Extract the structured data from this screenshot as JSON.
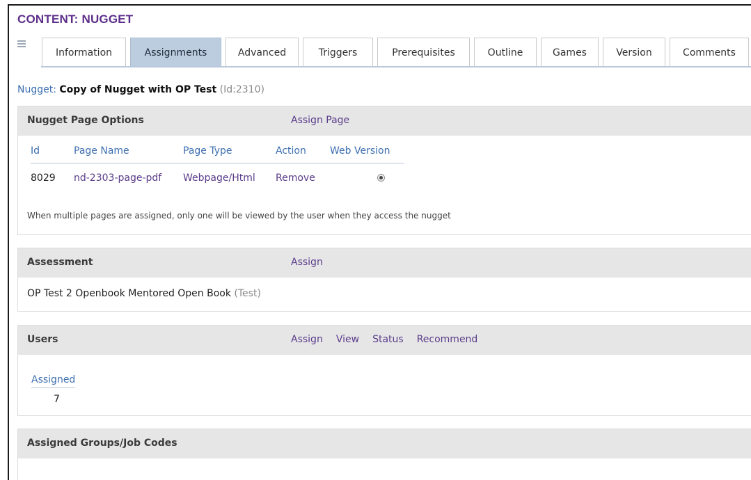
{
  "page": {
    "title": "CONTENT: NUGGET"
  },
  "tabs": [
    {
      "label": "Information"
    },
    {
      "label": "Assignments"
    },
    {
      "label": "Advanced"
    },
    {
      "label": "Triggers"
    },
    {
      "label": "Prerequisites"
    },
    {
      "label": "Outline"
    },
    {
      "label": "Games"
    },
    {
      "label": "Version"
    },
    {
      "label": "Comments"
    }
  ],
  "active_tab": "Assignments",
  "nugget": {
    "label": "Nugget:",
    "name": "Copy of Nugget with OP Test",
    "id_text": "(Id:2310)"
  },
  "page_options": {
    "title": "Nugget Page Options",
    "action": "Assign Page",
    "columns": [
      "Id",
      "Page Name",
      "Page Type",
      "Action",
      "Web Version"
    ],
    "rows": [
      {
        "id": "8029",
        "page_name": "nd-2303-page-pdf",
        "page_type": "Webpage/Html",
        "action": "Remove",
        "web_version_selected": true
      }
    ],
    "note": "When multiple pages are assigned, only one will be viewed by the user when they access the nugget"
  },
  "assessment": {
    "title": "Assessment",
    "action": "Assign",
    "item_name": "OP Test 2 Openbook Mentored Open Book",
    "item_type": "(Test)"
  },
  "users": {
    "title": "Users",
    "actions": [
      "Assign",
      "View",
      "Status",
      "Recommend"
    ],
    "assigned_label": "Assigned",
    "assigned_count": "7"
  },
  "groups": {
    "title": "Assigned Groups/Job Codes"
  },
  "colors": {
    "title": "#5c2d8a",
    "link": "#5a3c8a",
    "header_link": "#3d6fb0",
    "active_tab": "#bccde0",
    "panel_head": "#e6e6e6"
  }
}
